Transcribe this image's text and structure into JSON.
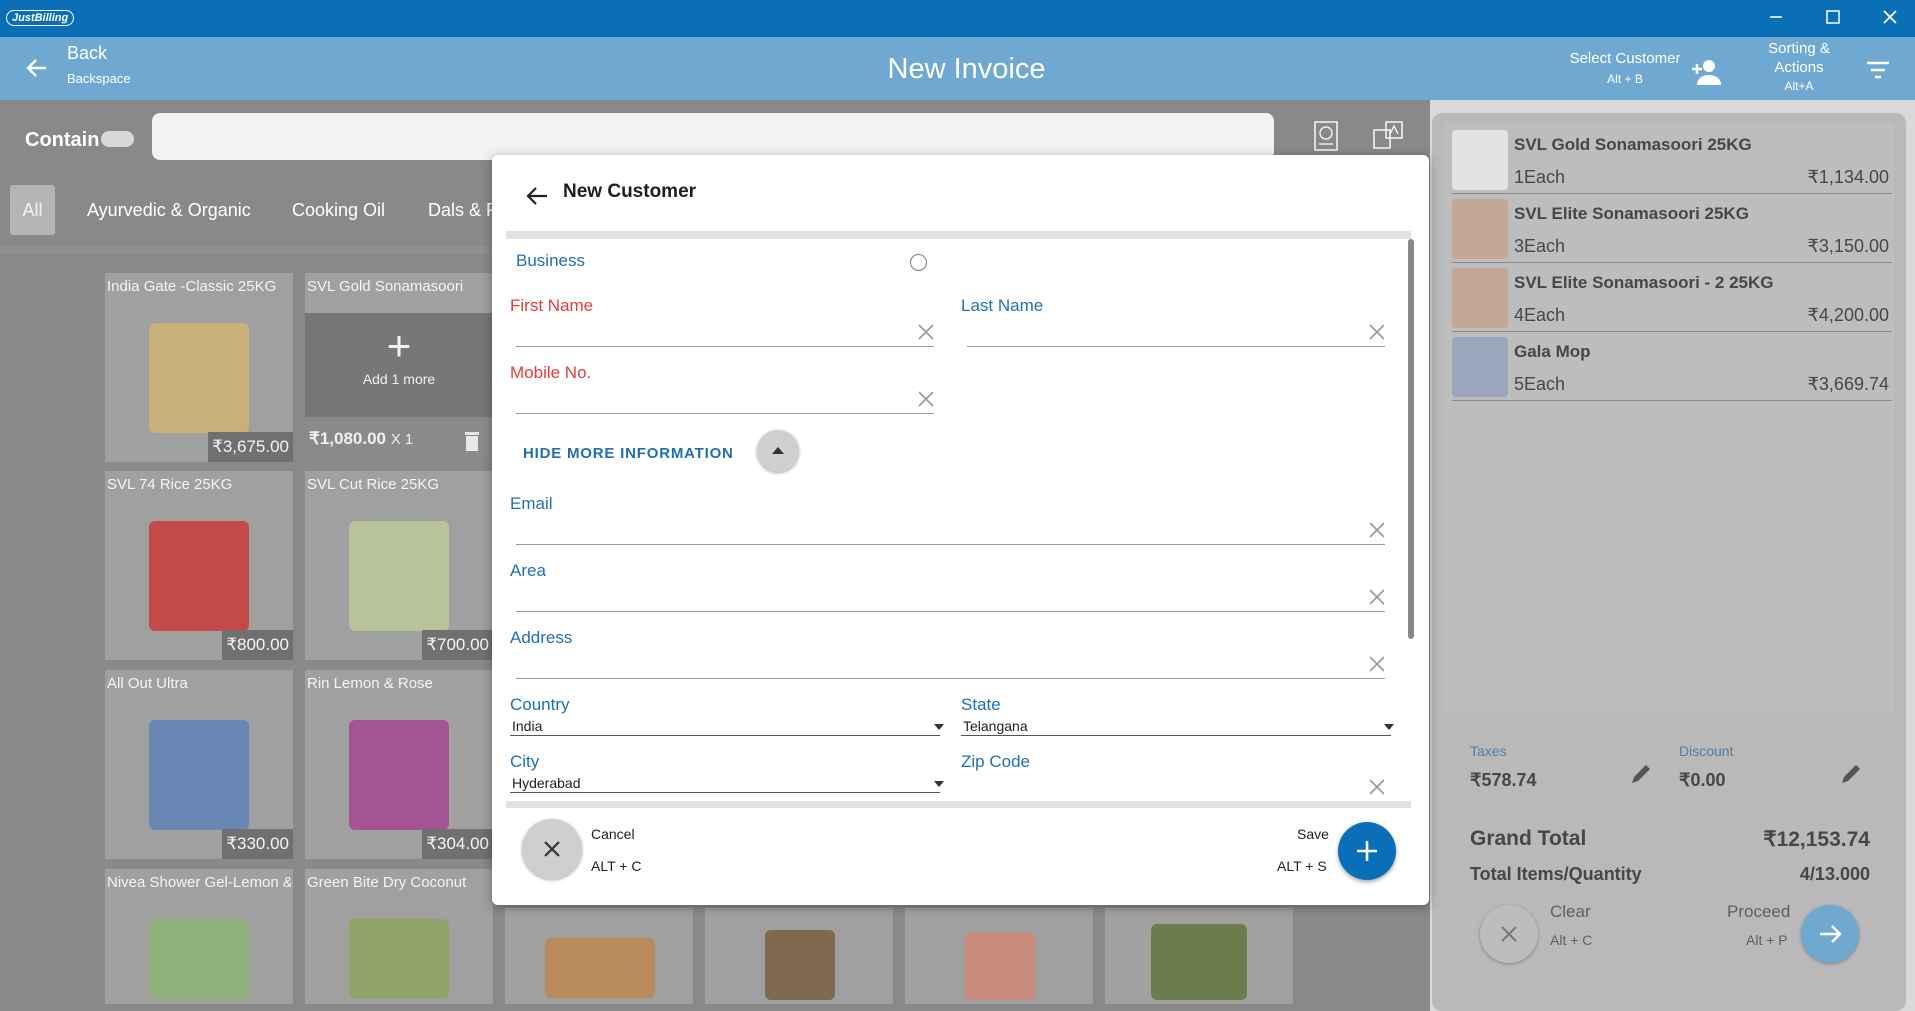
{
  "app": {
    "logo": "JustBilling"
  },
  "header": {
    "back_label": "Back",
    "back_hint": "Backspace",
    "title": "New Invoice",
    "select_customer": "Select Customer",
    "select_customer_hint": "Alt + B",
    "sorting_line1": "Sorting &",
    "sorting_line2": "Actions",
    "sorting_hint": "Alt+A"
  },
  "search": {
    "contain_label": "Contain",
    "placeholder": ""
  },
  "categories": [
    "All",
    "Ayurvedic & Organic",
    "Cooking Oil",
    "Dals & P"
  ],
  "products": [
    {
      "name": "India Gate -Classic 25KG",
      "price": "₹3,675.00",
      "img_color": "#c9b079"
    },
    {
      "name": "SVL Gold Sonamasoori",
      "added_text": "Add 1 more",
      "added_price": "₹1,080.00",
      "added_qty": "X 1"
    },
    {
      "name": "SVL  74 Rice 25KG",
      "price": "₹800.00",
      "img_color": "#c44a4a"
    },
    {
      "name": "SVL Cut Rice 25KG",
      "price": "₹700.00",
      "img_color": "#b7c39a"
    },
    {
      "name": "All Out Ultra",
      "price": "₹330.00",
      "img_color": "#6a86b4"
    },
    {
      "name": "Rin Lemon & Rose",
      "price": "₹304.00",
      "img_color": "#a45494"
    },
    {
      "name": "Nivea Shower Gel-Lemon &",
      "img_color": "#8fb07a"
    },
    {
      "name": "Green Bite Dry Coconut",
      "img_color": "#8fa468"
    }
  ],
  "cart": {
    "items": [
      {
        "name": "SVL Gold Sonamasoori 25KG",
        "qty": "1Each",
        "price": "₹1,134.00"
      },
      {
        "name": "SVL Elite Sonamasoori 25KG",
        "qty": "3Each",
        "price": "₹3,150.00"
      },
      {
        "name": "SVL Elite Sonamasoori - 2 25KG",
        "qty": "4Each",
        "price": "₹4,200.00"
      },
      {
        "name": "Gala Mop",
        "qty": "5Each",
        "price": "₹3,669.74"
      }
    ],
    "taxes_label": "Taxes",
    "taxes_value": "₹578.74",
    "discount_label": "Discount",
    "discount_value": "₹0.00",
    "grand_total_label": "Grand Total",
    "grand_total_value": "₹12,153.74",
    "total_items_label": "Total Items/Quantity",
    "total_items_value": "4/13.000",
    "clear_label": "Clear",
    "clear_hint": "Alt + C",
    "proceed_label": "Proceed",
    "proceed_hint": "Alt + P"
  },
  "modal": {
    "title": "New Customer",
    "business_label": "Business",
    "first_name_label": "First Name",
    "last_name_label": "Last Name",
    "mobile_label": "Mobile No.",
    "hide_more": "HIDE MORE INFORMATION",
    "email_label": "Email",
    "area_label": "Area",
    "address_label": "Address",
    "country_label": "Country",
    "country_value": "India",
    "state_label": "State",
    "state_value": "Telangana",
    "city_label": "City",
    "city_value": "Hyderabad",
    "zip_label": "Zip Code",
    "cancel_label": "Cancel",
    "cancel_hint": "ALT + C",
    "save_label": "Save",
    "save_hint": "ALT + S"
  },
  "colors": {
    "primary": "#0b6fb8",
    "header": "#6fa8d0",
    "required": "#e43c3c",
    "label_blue": "#1f6fb6"
  }
}
